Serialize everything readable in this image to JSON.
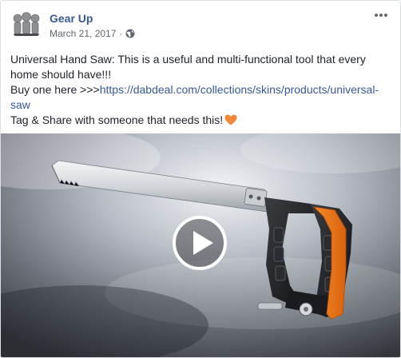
{
  "post": {
    "page_name": "Gear Up",
    "date": "March 21, 2017",
    "separator": "·",
    "audience_icon": "globe-icon",
    "more_icon": "more-options-icon",
    "text_line1": "Universal Hand Saw: This is a useful and multi-functional tool that every",
    "text_line2": "home should have!!!",
    "text_line3_prefix": "Buy one here >>>",
    "link_part1": "https://dabdeal.com/collections/skins/products/universal-",
    "link_part2": "saw",
    "text_line5": "Tag & Share with someone that needs this!",
    "heart_icon": "orange-heart-icon",
    "heart_color": "#f0883a",
    "link_color": "#365899"
  },
  "video": {
    "play_icon": "play-button-icon",
    "handle_color": "#f07a1a"
  }
}
